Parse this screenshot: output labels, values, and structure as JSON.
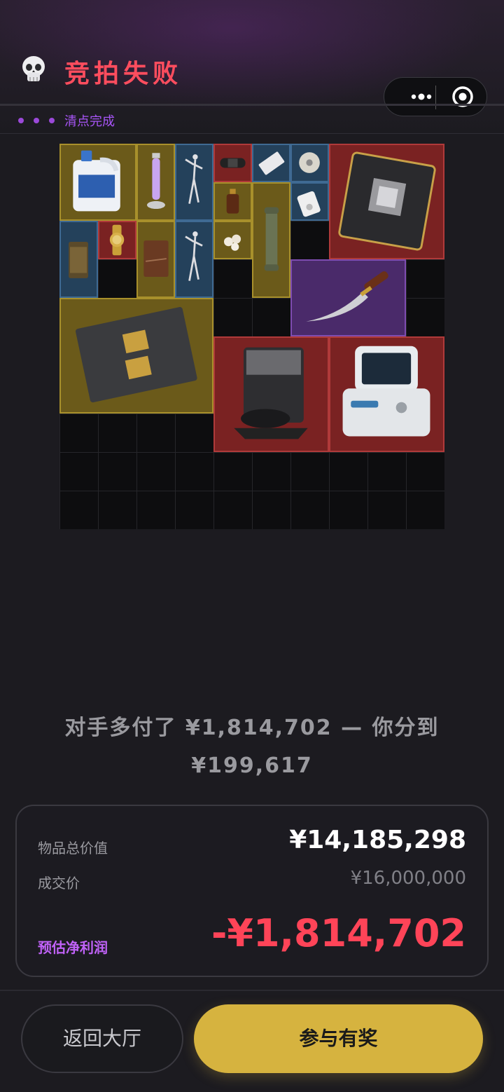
{
  "header": {
    "title": "竞拍失败",
    "status_label": "清点完成"
  },
  "grid": {
    "columns": 10,
    "rows": 10
  },
  "items": [
    {
      "name": "detergent-jug",
      "rarity": "yellow"
    },
    {
      "name": "uv-lamp",
      "rarity": "yellow"
    },
    {
      "name": "dancer-figurine",
      "rarity": "blue"
    },
    {
      "name": "smart-band",
      "rarity": "red"
    },
    {
      "name": "chip-card",
      "rarity": "blue"
    },
    {
      "name": "disc",
      "rarity": "blue"
    },
    {
      "name": "gpu-board",
      "rarity": "red"
    },
    {
      "name": "perfume-bottle",
      "rarity": "yellow"
    },
    {
      "name": "mp3-player",
      "rarity": "blue"
    },
    {
      "name": "binoculars-tube",
      "rarity": "yellow"
    },
    {
      "name": "ammo-box",
      "rarity": "blue"
    },
    {
      "name": "gold-watch",
      "rarity": "red"
    },
    {
      "name": "leather-journal",
      "rarity": "yellow"
    },
    {
      "name": "dancer-figurine",
      "rarity": "blue"
    },
    {
      "name": "pearls",
      "rarity": "yellow"
    },
    {
      "name": "hunting-knife",
      "rarity": "purple"
    },
    {
      "name": "server-motherboard",
      "rarity": "yellow"
    },
    {
      "name": "robot-vacuum-dock",
      "rarity": "red"
    },
    {
      "name": "medical-monitor",
      "rarity": "red"
    }
  ],
  "message": {
    "line1": "对手多付了 ¥1,814,702 — 你分到",
    "line2": "¥199,617"
  },
  "summary": {
    "total_label": "物品总价值",
    "total_value": "¥14,185,298",
    "deal_label": "成交价",
    "deal_value": "¥16,000,000",
    "profit_label": "预估净利润",
    "profit_value": "-¥1,814,702"
  },
  "buttons": {
    "back_label": "返回大厅",
    "join_label": "参与有奖"
  },
  "colors": {
    "title": "#ff4d5e",
    "status": "#a855f7",
    "profit": "#ff4458",
    "join_button": "#d6b33f"
  }
}
